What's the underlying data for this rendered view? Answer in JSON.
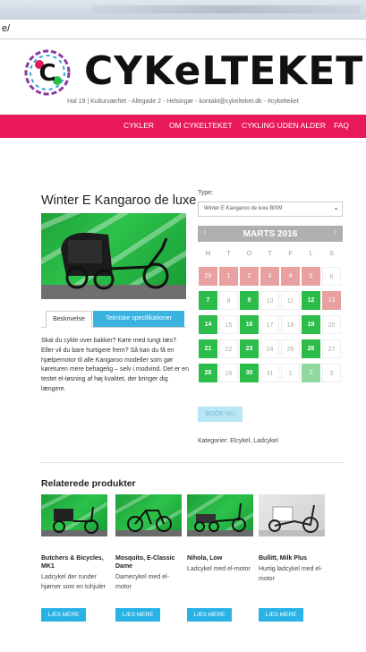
{
  "browser": {
    "address": "e/"
  },
  "header": {
    "logo_text": "CYKeLTEKET",
    "tagline": "Hal 19 | Kulturværftet - Allegade 2 - Helsingør - kontakt@cykelteket.dk - #cykelteket"
  },
  "nav": [
    "CYKLER",
    "OM CYKELTEKET",
    "CYKLING UDEN ALDER",
    "FAQ"
  ],
  "product": {
    "title": "Winter E Kangaroo de luxe",
    "tabs": [
      "Beskrivelse",
      "Tekniske specifikationer"
    ],
    "description": "Skal du cykle over bakker? Køre med tungt læs? Eller vil du bare hurtigere frem? Så kan du få en hjælpemotor til alle Kangaroo modeller som gør køreturen mere behagelig – selv i modvind. Det er en testet el-løsning af høj kvalitet, der bringer dig længere."
  },
  "booking": {
    "type_label": "Type:",
    "type_value": "Winter E Kangaroo de luxe B009",
    "month": "MARTS 2016",
    "weekdays": [
      "M",
      "T",
      "O",
      "T",
      "F",
      "L",
      "S"
    ],
    "days": [
      [
        {
          "d": "29",
          "s": "red"
        },
        {
          "d": "1",
          "s": "red"
        },
        {
          "d": "2",
          "s": "red"
        },
        {
          "d": "3",
          "s": "red"
        },
        {
          "d": "4",
          "s": "red"
        },
        {
          "d": "5",
          "s": "red"
        },
        {
          "d": "6",
          "s": "white"
        }
      ],
      [
        {
          "d": "7",
          "s": "green"
        },
        {
          "d": "8",
          "s": "white"
        },
        {
          "d": "9",
          "s": "green"
        },
        {
          "d": "10",
          "s": "white"
        },
        {
          "d": "11",
          "s": "white"
        },
        {
          "d": "12",
          "s": "green"
        },
        {
          "d": "13",
          "s": "red"
        }
      ],
      [
        {
          "d": "14",
          "s": "green"
        },
        {
          "d": "15",
          "s": "white"
        },
        {
          "d": "16",
          "s": "green"
        },
        {
          "d": "17",
          "s": "white"
        },
        {
          "d": "18",
          "s": "white"
        },
        {
          "d": "19",
          "s": "green"
        },
        {
          "d": "20",
          "s": "white"
        }
      ],
      [
        {
          "d": "21",
          "s": "green"
        },
        {
          "d": "22",
          "s": "white"
        },
        {
          "d": "23",
          "s": "green"
        },
        {
          "d": "24",
          "s": "white"
        },
        {
          "d": "25",
          "s": "white"
        },
        {
          "d": "26",
          "s": "green"
        },
        {
          "d": "27",
          "s": "white"
        }
      ],
      [
        {
          "d": "28",
          "s": "green"
        },
        {
          "d": "29",
          "s": "white"
        },
        {
          "d": "30",
          "s": "green"
        },
        {
          "d": "31",
          "s": "white"
        },
        {
          "d": "1",
          "s": "white"
        },
        {
          "d": "2",
          "s": "lgreen"
        },
        {
          "d": "3",
          "s": "white"
        }
      ]
    ],
    "book_label": "BOOK NU",
    "categories": "Kategorier: Elcykel, Ladcykel",
    "colors": {
      "booked": "#e8a0a0",
      "available": "#2bbc4a",
      "selected": "#8fd8a0"
    }
  },
  "related": {
    "title": "Relaterede produkter",
    "items": [
      {
        "name": "Butchers & Bicycles, MK1",
        "desc": "Ladcykel der runder hjørner som en tohjuler",
        "button": "LÆS MERE"
      },
      {
        "name": "Mosquito, E-Classic Dame",
        "desc": "Damecykel med el-motor",
        "button": "LÆS MERE"
      },
      {
        "name": "Nihola, Low",
        "desc": "Ladcykel med el-motor",
        "button": "LÆS MERE"
      },
      {
        "name": "Bullitt, Milk Plus",
        "desc": "Hurtig ladcykel med el-motor",
        "button": "LÆS MERE"
      }
    ]
  },
  "colors": {
    "accent": "#e8185a",
    "button": "#29b2e6"
  }
}
